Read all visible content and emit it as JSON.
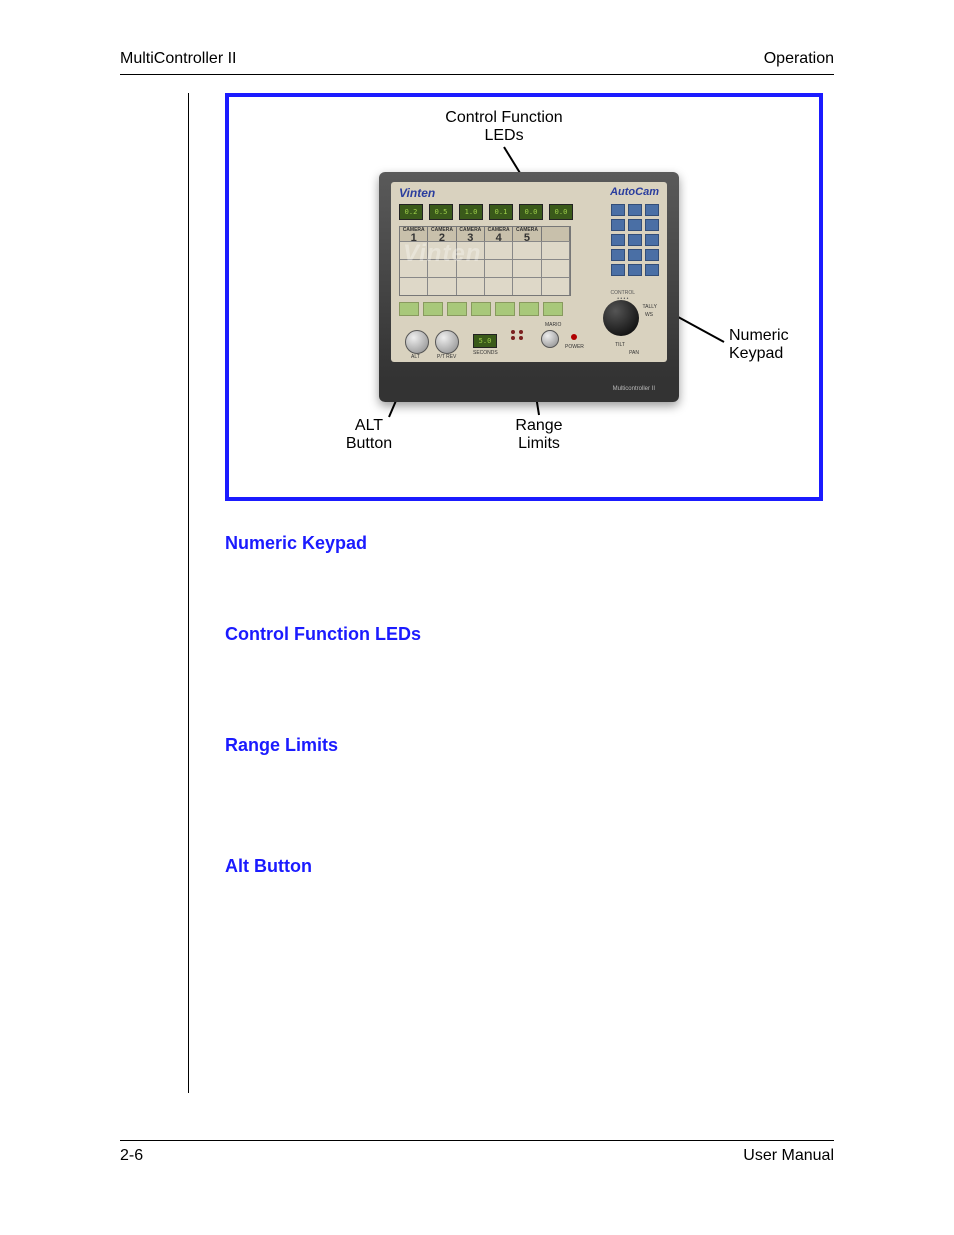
{
  "header": {
    "left": "MultiController II",
    "right": "Operation"
  },
  "figure": {
    "callouts": {
      "top": "Control Function\nLEDs",
      "right": "Numeric\nKeypad",
      "bottom_left": "ALT\nButton",
      "bottom_right": "Range\nLimits"
    },
    "device": {
      "brand_left": "Vinten",
      "brand_right": "AutoCam",
      "watermark": "Vinten",
      "lcds": [
        "0.2",
        "0.5",
        "1.0",
        "0.1",
        "0.0",
        "0.0"
      ],
      "camera_headers": [
        {
          "top": "CAMERA",
          "num": "1"
        },
        {
          "top": "CAMERA",
          "num": "2"
        },
        {
          "top": "CAMERA",
          "num": "3"
        },
        {
          "top": "CAMERA",
          "num": "4"
        },
        {
          "top": "CAMERA",
          "num": "5"
        },
        {
          "top": "",
          "num": ""
        }
      ],
      "center_lcd": "5.0",
      "labels": {
        "control": "CONTROL",
        "tally": "TALLY",
        "ws": "WS",
        "power": "POWER",
        "pan": "PAN",
        "seconds": "SECONDS",
        "ptrev": "P/T REV",
        "alt": "ALT",
        "mario": "MARIO",
        "tilt": "TILT",
        "model": "Multicontroller II"
      }
    }
  },
  "sections": [
    {
      "title": "Numeric Keypad"
    },
    {
      "title": "Control Function LEDs"
    },
    {
      "title": "Range Limits"
    },
    {
      "title": "Alt Button"
    }
  ],
  "footer": {
    "left": "2-6",
    "right": "User Manual"
  }
}
